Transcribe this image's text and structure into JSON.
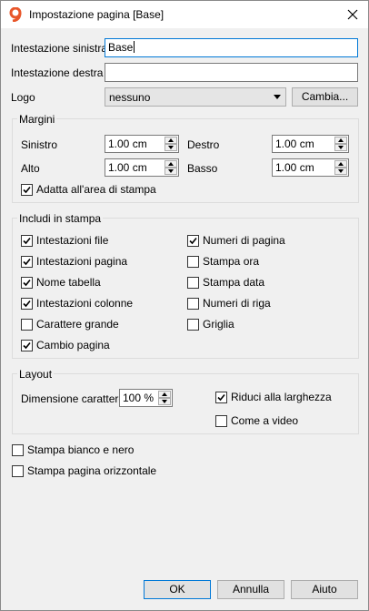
{
  "window": {
    "title": "Impostazione pagina [Base]"
  },
  "header": {
    "left_label": "Intestazione sinistra",
    "left_value": "Base",
    "right_label": "Intestazione destra",
    "right_value": "",
    "logo_label": "Logo",
    "logo_value": "nessuno",
    "change_button": "Cambia..."
  },
  "margins": {
    "title": "Margini",
    "left_label": "Sinistro",
    "left_value": "1.00 cm",
    "right_label": "Destro",
    "right_value": "1.00 cm",
    "top_label": "Alto",
    "top_value": "1.00 cm",
    "bottom_label": "Basso",
    "bottom_value": "1.00 cm",
    "fit_label": "Adatta all'area di stampa",
    "fit_checked": true
  },
  "include": {
    "title": "Includi in stampa",
    "left": [
      {
        "label": "Intestazioni file",
        "checked": true
      },
      {
        "label": "Intestazioni pagina",
        "checked": true
      },
      {
        "label": "Nome tabella",
        "checked": true
      },
      {
        "label": "Intestazioni colonne",
        "checked": true
      },
      {
        "label": "Carattere grande",
        "checked": false
      },
      {
        "label": "Cambio pagina",
        "checked": true
      }
    ],
    "right": [
      {
        "label": "Numeri di pagina",
        "checked": true
      },
      {
        "label": "Stampa ora",
        "checked": false
      },
      {
        "label": "Stampa data",
        "checked": false
      },
      {
        "label": "Numeri di riga",
        "checked": false
      },
      {
        "label": "Griglia",
        "checked": false
      }
    ]
  },
  "layout": {
    "title": "Layout",
    "font_size_label": "Dimensione carattere",
    "font_size_value": "100 %",
    "shrink_label": "Riduci alla larghezza",
    "shrink_checked": true,
    "screen_label": "Come a video",
    "screen_checked": false
  },
  "options": {
    "bw_label": "Stampa bianco e nero",
    "bw_checked": false,
    "landscape_label": "Stampa pagina orizzontale",
    "landscape_checked": false
  },
  "footer": {
    "ok": "OK",
    "cancel": "Annulla",
    "help": "Aiuto"
  },
  "colors": {
    "focus_border": "#0078d7",
    "app_icon": "#e8562a"
  },
  "icons": {
    "app": "app-logo-icon",
    "close": "close-icon",
    "check": "check-icon"
  }
}
